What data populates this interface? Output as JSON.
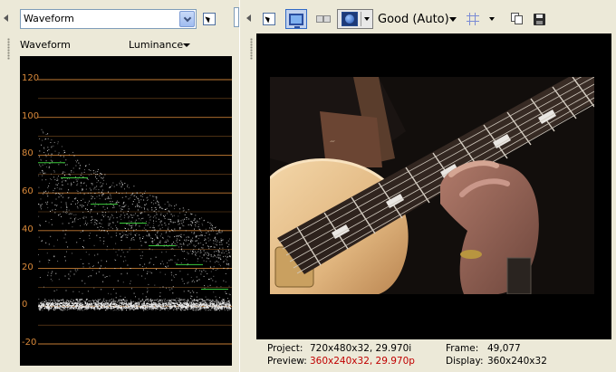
{
  "left_panel": {
    "scope_select": {
      "value": "Waveform"
    },
    "scope_title": "Waveform",
    "mode": {
      "label": "Luminance"
    },
    "scale_ticks": [
      "120",
      "100",
      "80",
      "60",
      "40",
      "20",
      "0",
      "-20"
    ]
  },
  "right_panel": {
    "toolbar": {
      "quality": {
        "label": "Good (Auto)"
      }
    },
    "status": {
      "project_label": "Project:",
      "project_value": "720x480x32, 29.970i",
      "preview_label": "Preview:",
      "preview_value": "360x240x32, 29.970p",
      "frame_label": "Frame:",
      "frame_value": "49,077",
      "display_label": "Display:",
      "display_value": "360x240x32"
    }
  },
  "colors": {
    "scale_line": "#d9893a",
    "scale_text": "#d9893a",
    "trace": "#e8e8e8",
    "target_marks": "#3cc83c",
    "status_red": "#c00000"
  },
  "icons": {
    "collapse": "chevron-left-icon",
    "grip": "grip-icon",
    "pointer": "pointer-tool-icon",
    "monitor": "video-preview-icon",
    "overlays": "overlays-icon",
    "quality": "preview-quality-icon",
    "grid": "grid-icon",
    "copy": "copy-snapshot-icon",
    "save": "save-snapshot-icon"
  }
}
